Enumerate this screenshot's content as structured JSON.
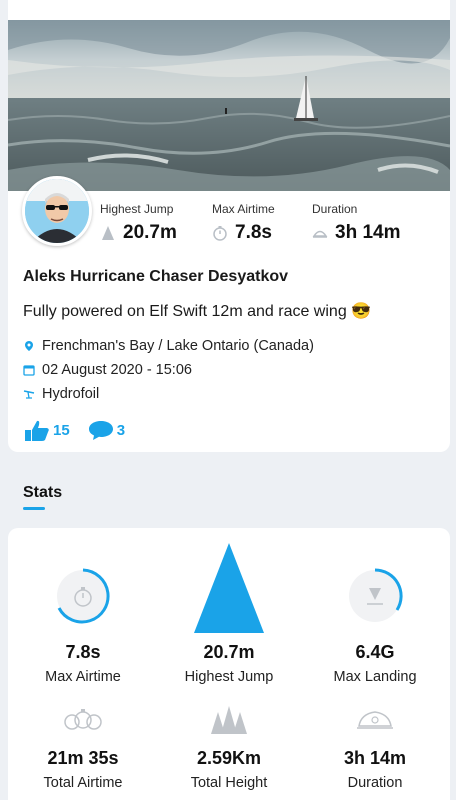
{
  "session": {
    "highest_jump_label": "Highest Jump",
    "highest_jump_value": "20.7m",
    "max_airtime_label": "Max Airtime",
    "max_airtime_value": "7.8s",
    "duration_label": "Duration",
    "duration_value": "3h 14m",
    "rider_name": "Aleks Hurricane Chaser Desyatkov",
    "description": "Fully powered on Elf Swift 12m and race wing 😎",
    "location": "Frenchman's Bay / Lake Ontario (Canada)",
    "date": "02 August 2020 - 15:06",
    "sport": "Hydrofoil",
    "likes": "15",
    "comments": "3"
  },
  "stats_section": {
    "title": "Stats",
    "items": [
      {
        "value": "7.8s",
        "label": "Max Airtime",
        "icon": "stopwatch-icon"
      },
      {
        "value": "20.7m",
        "label": "Highest Jump",
        "icon": "triangle-jump-icon"
      },
      {
        "value": "6.4G",
        "label": "Max Landing",
        "icon": "landing-icon"
      },
      {
        "value": "21m 35s",
        "label": "Total Airtime",
        "icon": "multi-stopwatch-icon"
      },
      {
        "value": "2.59Km",
        "label": "Total Height",
        "icon": "triangles-icon"
      },
      {
        "value": "3h 14m",
        "label": "Duration",
        "icon": "duration-icon"
      }
    ]
  },
  "colors": {
    "accent": "#1aa3e8",
    "background": "#edf0f4",
    "icon_gray": "#b9bfc6"
  }
}
